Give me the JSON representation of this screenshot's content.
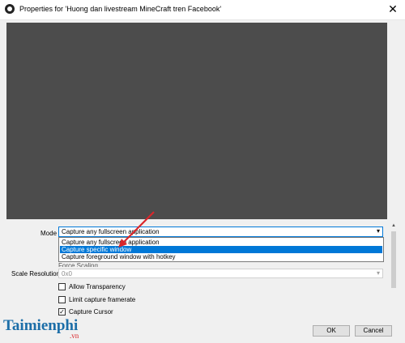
{
  "window": {
    "title": "Properties for 'Huong dan livestream MineCraft tren Facebook'",
    "close_glyph": "✕"
  },
  "form": {
    "mode_label": "Mode",
    "mode_value": "Capture any fullscreen application",
    "mode_options": [
      "Capture any fullscreen application",
      "Capture specific window",
      "Capture foreground window with hotkey"
    ],
    "partially_hidden_option": "Force Scaling",
    "scale_label": "Scale Resolution",
    "scale_value": "0x0",
    "checkboxes": [
      {
        "label": "Allow Transparency",
        "checked": false
      },
      {
        "label": "Limit capture framerate",
        "checked": false
      },
      {
        "label": "Capture Cursor",
        "checked": true
      }
    ],
    "check_glyph": "✓",
    "arrow_glyph": "▾"
  },
  "buttons": {
    "ok": "OK",
    "cancel": "Cancel"
  },
  "watermark": {
    "main": "Taimienphi",
    "sub": ".vn"
  },
  "colors": {
    "accent": "#0078d7",
    "annotation": "#d9262b"
  }
}
